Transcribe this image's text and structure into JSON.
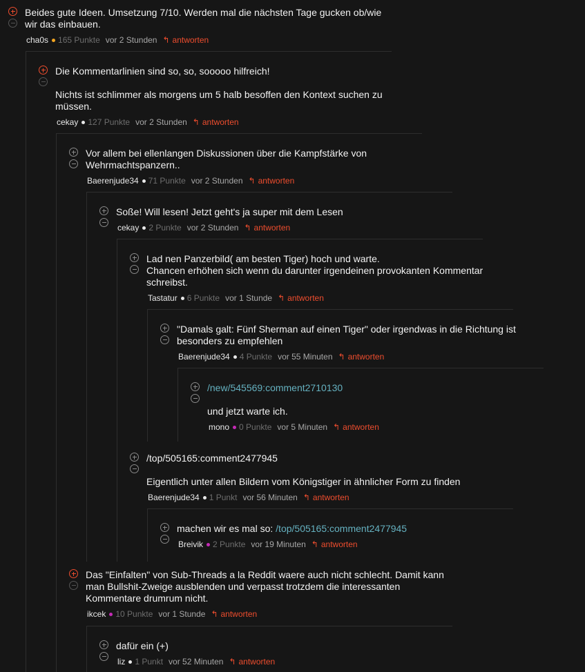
{
  "reply_label": "antworten",
  "colors": {
    "accent": "#ee4d2e",
    "link": "#65b1c0",
    "dot_white": "#e8e8e8",
    "dot_orange": "#f3a521",
    "dot_purple": "#c52bb6"
  },
  "comments": [
    {
      "id": "c1",
      "lines": [
        "Beides gute Ideen. Umsetzung 7/10. Werden mal die nächsten Tage gucken ob/wie",
        "wir das einbauen."
      ],
      "user": "cha0s",
      "dot": "orange",
      "points": "165 Punkte",
      "time": "vor 2 Stunden"
    },
    {
      "id": "c2",
      "lines": [
        "Die Kommentarlinien sind so, so, sooooo hilfreich!"
      ],
      "lines2": [
        "Nichts ist schlimmer als morgens um 5 halb besoffen den Kontext suchen zu",
        "müssen."
      ],
      "user": "cekay",
      "dot": "white",
      "points": "127 Punkte",
      "time": "vor 2 Stunden"
    },
    {
      "id": "c3",
      "lines": [
        "Vor allem bei ellenlangen Diskussionen über die Kampfstärke von",
        "Wehrmachtspanzern.."
      ],
      "user": "Baerenjude34",
      "dot": "white",
      "points": "71 Punkte",
      "time": "vor 2 Stunden"
    },
    {
      "id": "c4",
      "lines": [
        "Soße! Will lesen! Jetzt geht's ja super mit dem Lesen"
      ],
      "user": "cekay",
      "dot": "white",
      "points": "2 Punkte",
      "time": "vor 2 Stunden"
    },
    {
      "id": "c5",
      "lines": [
        "Lad nen Panzerbild( am besten Tiger) hoch und warte.",
        "Chancen erhöhen sich wenn du darunter irgendeinen provokanten Kommentar",
        "schreibst."
      ],
      "user": "Tastatur",
      "dot": "white",
      "points": "6 Punkte",
      "time": "vor 1 Stunde"
    },
    {
      "id": "c6",
      "lines": [
        "\"Damals galt: Fünf Sherman auf einen Tiger\" oder irgendwas in die Richtung ist",
        "besonders zu empfehlen"
      ],
      "user": "Baerenjude34",
      "dot": "white",
      "points": "4 Punkte",
      "time": "vor 55 Minuten"
    },
    {
      "id": "c7",
      "link": "/new/545569:comment2710130",
      "lines2": [
        "und jetzt warte ich."
      ],
      "user": "mono",
      "dot": "purple",
      "points": "0 Punkte",
      "time": "vor 5 Minuten"
    },
    {
      "id": "c8",
      "lines": [
        "/top/505165:comment2477945"
      ],
      "lines2": [
        "Eigentlich unter allen Bildern vom Königstiger in ähnlicher Form zu finden"
      ],
      "user": "Baerenjude34",
      "dot": "white",
      "points": "1 Punkt",
      "time": "vor 56 Minuten"
    },
    {
      "id": "c9",
      "prefix": "machen wir es mal so: ",
      "link": "/top/505165:comment2477945",
      "user": "Breivik",
      "dot": "purple",
      "points": "2 Punkte",
      "time": "vor 19 Minuten"
    },
    {
      "id": "c10",
      "lines": [
        "Das \"Einfalten\" von Sub-Threads a la Reddit waere auch nicht schlecht. Damit kann",
        "man Bullshit-Zweige ausblenden und verpasst trotzdem die interessanten",
        "Kommentare drumrum nicht."
      ],
      "user": "ikcek",
      "dot": "purple",
      "points": "10 Punkte",
      "time": "vor 1 Stunde"
    },
    {
      "id": "c11",
      "lines": [
        "dafür ein (+)"
      ],
      "user": "liz",
      "dot": "white",
      "points": "1 Punkt",
      "time": "vor 52 Minuten"
    }
  ]
}
